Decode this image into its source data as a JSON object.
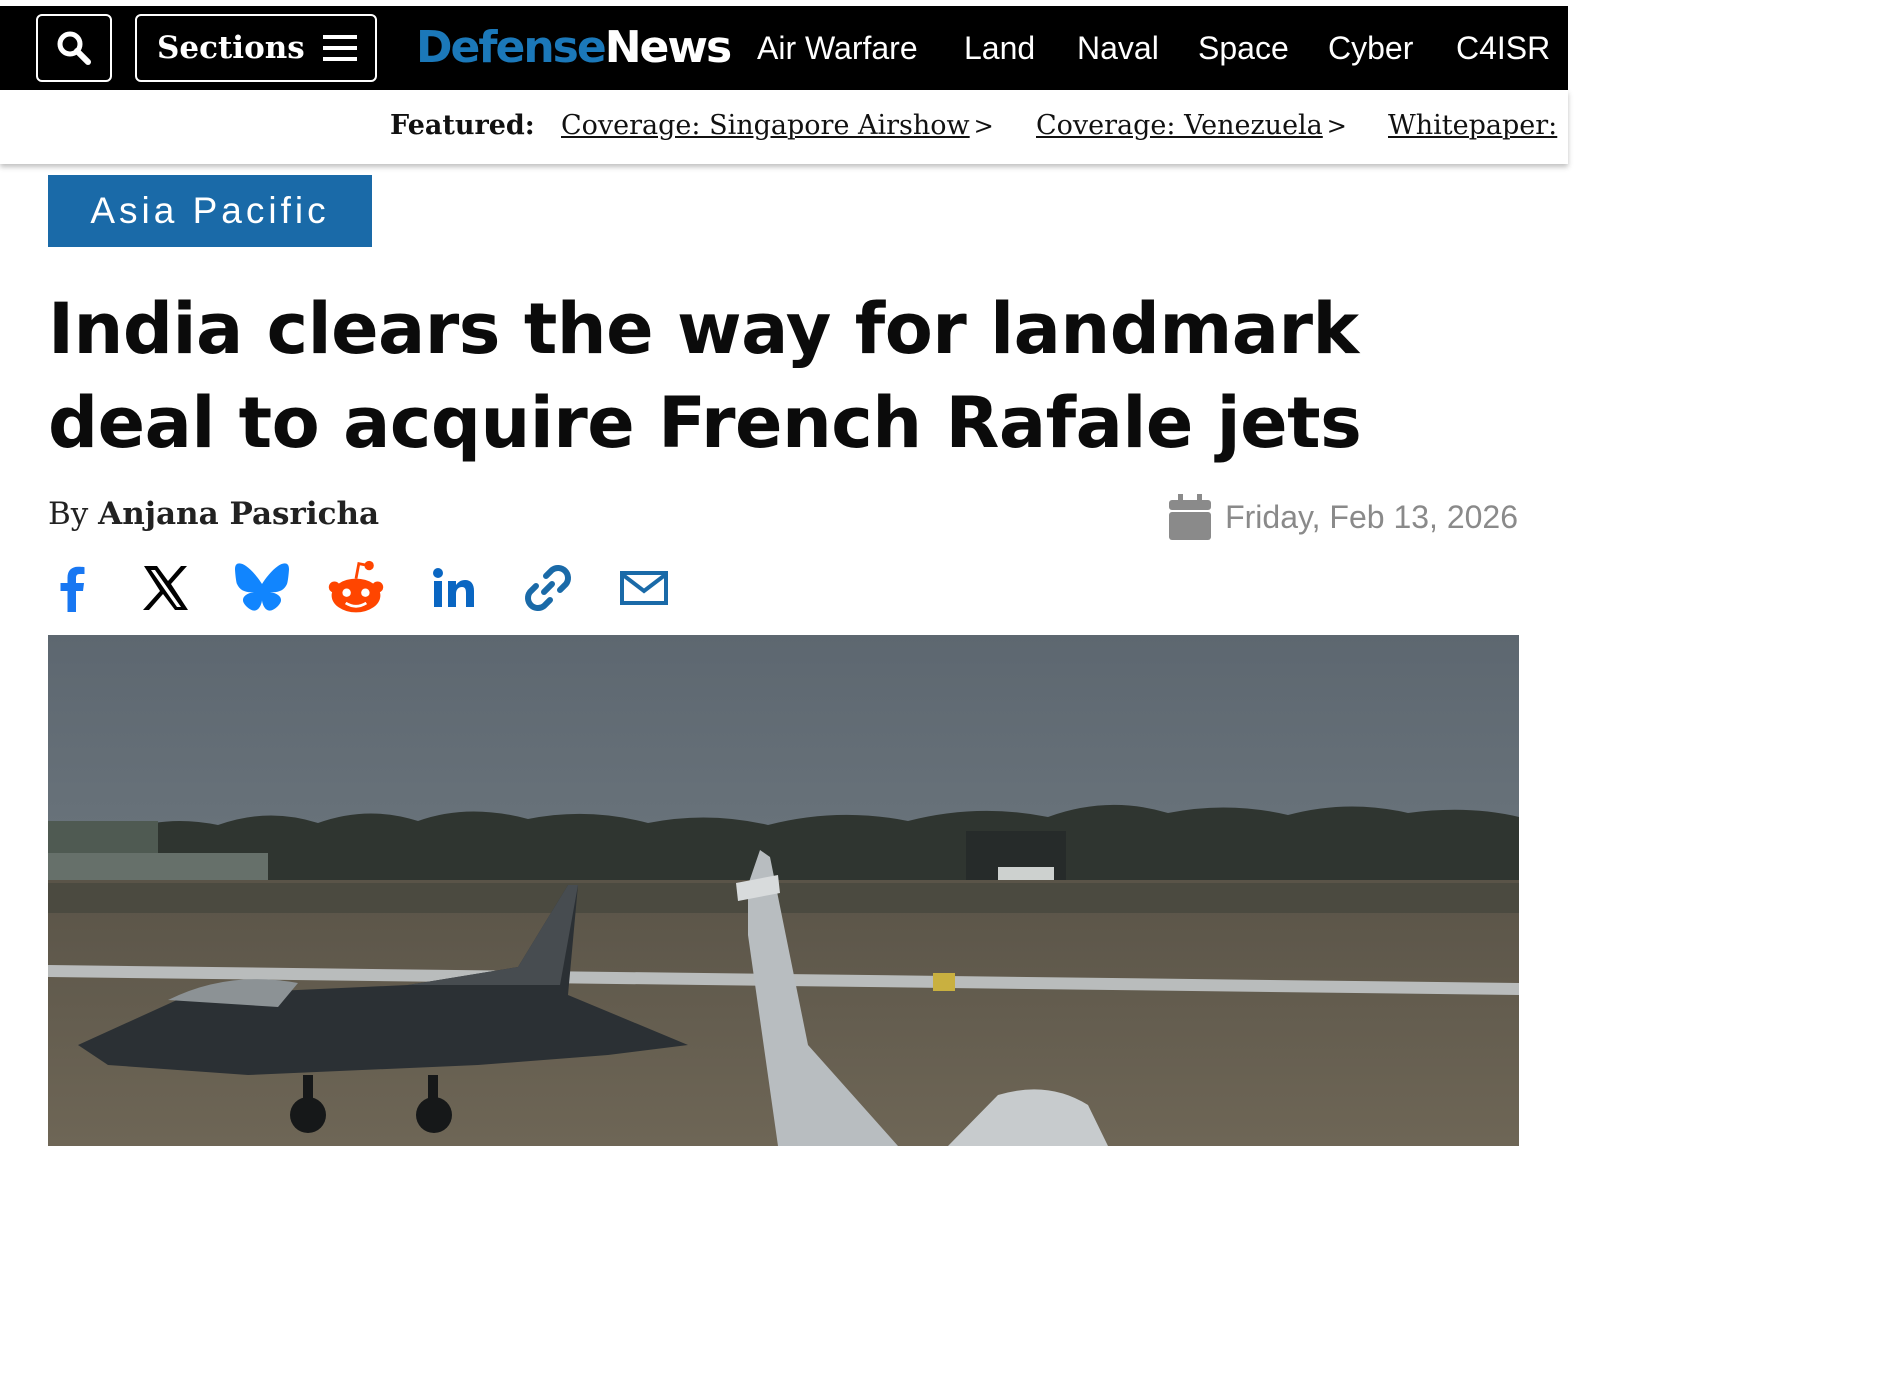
{
  "header": {
    "sections_label": "Sections",
    "logo_part1": "Defense",
    "logo_part2": "News",
    "nav": [
      "Air Warfare",
      "Land",
      "Naval",
      "Space",
      "Cyber",
      "C4ISR"
    ]
  },
  "featured": {
    "label": "Featured:",
    "links": [
      "Coverage: Singapore Airshow",
      "Coverage: Venezuela",
      "Whitepaper:"
    ]
  },
  "article": {
    "category": "Asia Pacific",
    "headline": "India clears the way for landmark deal to acquire French Rafale jets",
    "byline_prefix": "By",
    "author": "Anjana Pasricha",
    "date": "Friday, Feb 13, 2026"
  },
  "share_icons": [
    "facebook-icon",
    "x-icon",
    "bluesky-icon",
    "reddit-icon",
    "linkedin-icon",
    "link-icon",
    "email-icon"
  ],
  "colors": {
    "brand_blue": "#1b78b9",
    "category_blue": "#1a6aa8",
    "share_blue": "#1877f2",
    "reddit": "#ff4500"
  }
}
